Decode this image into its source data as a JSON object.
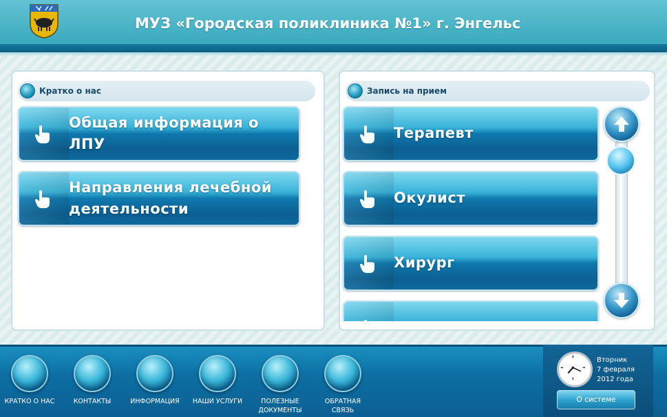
{
  "header": {
    "title": "МУЗ «Городская поликлиника №1» г. Энгельс",
    "logo_icon": "coat-of-arms-icon"
  },
  "left_panel": {
    "heading": "Кратко о нас",
    "buttons": [
      {
        "label_line1": "Общая информация о",
        "label_line2": "ЛПУ"
      },
      {
        "label_line1": "Направления лечебной",
        "label_line2": "деятельности"
      }
    ]
  },
  "right_panel": {
    "heading": "Запись на прием",
    "buttons": [
      {
        "label": "Терапевт"
      },
      {
        "label": "Окулист"
      },
      {
        "label": "Хирург"
      },
      {
        "label": ""
      }
    ]
  },
  "footer": {
    "nav": [
      {
        "label": "КРАТКО О НАС"
      },
      {
        "label": "КОНТАКТЫ"
      },
      {
        "label": "ИНФОРМАЦИЯ"
      },
      {
        "label": "НАШИ УСЛУГИ"
      },
      {
        "label_line1": "ПОЛЕЗНЫЕ",
        "label_line2": "ДОКУМЕНТЫ"
      },
      {
        "label_line1": "ОБРАТНАЯ",
        "label_line2": "СВЯЗЬ"
      }
    ],
    "date": {
      "weekday": "Вторник",
      "date": "7 февраля",
      "year": "2012 года"
    },
    "about_button": "О системе"
  },
  "colors": {
    "accent": "#0d6fa3",
    "header": "#4ab7c9",
    "button_top": "#7fd8ef",
    "button_bottom": "#0c5f91"
  }
}
